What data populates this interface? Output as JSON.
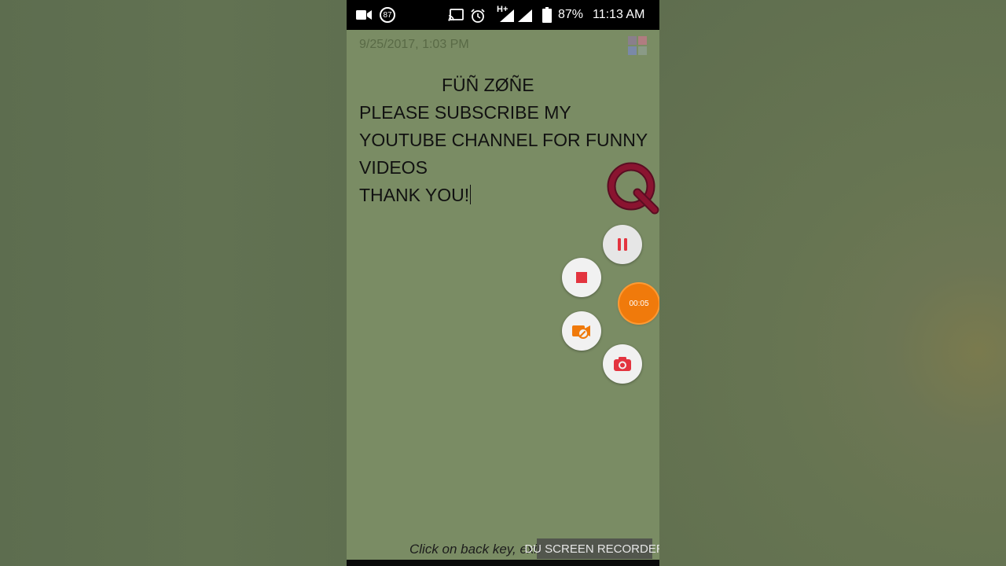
{
  "status_bar": {
    "notification_count": "87",
    "network_type": "H+",
    "battery": "87%",
    "time": "11:13 AM",
    "icons": [
      "video-camera-icon",
      "notification-badge-icon",
      "cast-icon",
      "alarm-icon",
      "signal-icon",
      "battery-icon"
    ]
  },
  "note": {
    "date": "9/25/2017, 1:03 PM",
    "lines": [
      "FÜÑ ZØÑE",
      "PLEASE SUBSCRIBE MY",
      "YOUTUBE CHANNEL FOR FUNNY",
      "VIDEOS",
      "THANK YOU!"
    ]
  },
  "recorder": {
    "timer": "00:05",
    "controls": [
      "pause-icon",
      "stop-icon",
      "tools-icon",
      "screenshot-camera-icon"
    ]
  },
  "hint": "Click on back key, exit",
  "watermark": "DU SCREEN RECORDER",
  "colors": {
    "note_background": "#7a8c64",
    "record_red": "#e3343f",
    "timer_orange": "#f07a0b",
    "logo_maroon": "#8a1430"
  }
}
